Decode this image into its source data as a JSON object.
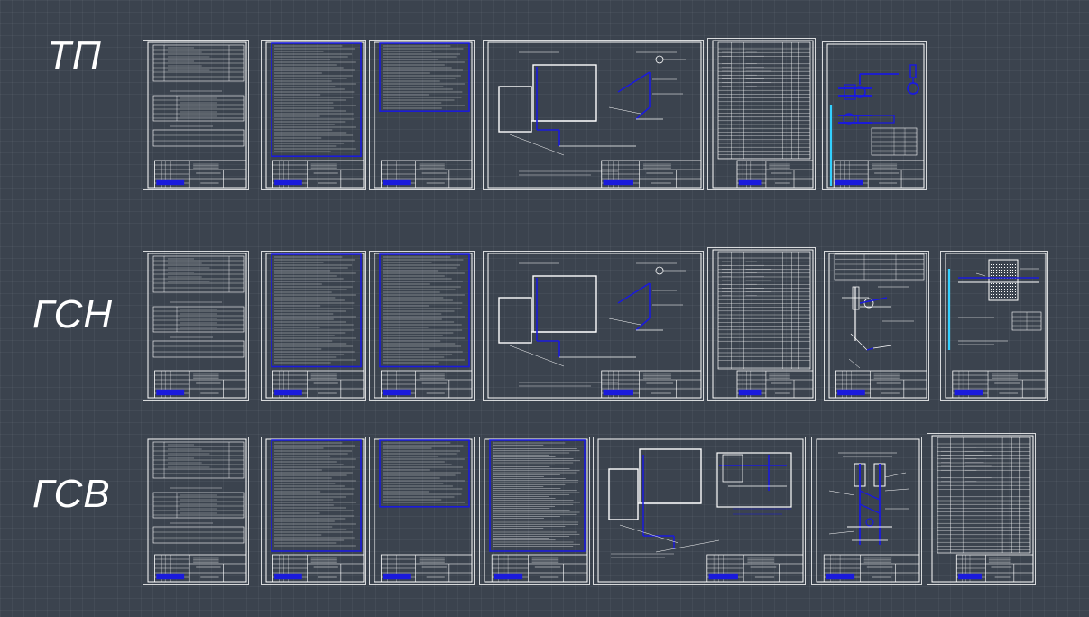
{
  "rows": [
    {
      "label": "ТП",
      "sheet_kinds": [
        "title",
        "text",
        "text-short",
        "plan",
        "spec",
        "detail-valve"
      ]
    },
    {
      "label": "ГСН",
      "sheet_kinds": [
        "title",
        "text",
        "text",
        "plan",
        "spec",
        "detail-node",
        "detail-section"
      ]
    },
    {
      "label": "ГСВ",
      "sheet_kinds": [
        "title",
        "text",
        "text-short",
        "text-dense",
        "plan-wide",
        "detail-riser",
        "spec"
      ]
    }
  ],
  "colors": {
    "background": "#3b434e",
    "sheet_line": "#ffffff",
    "accent": "#1a1adc",
    "cyan": "#33d0ff"
  },
  "icons": [
    "drawing-sheet-icon"
  ]
}
